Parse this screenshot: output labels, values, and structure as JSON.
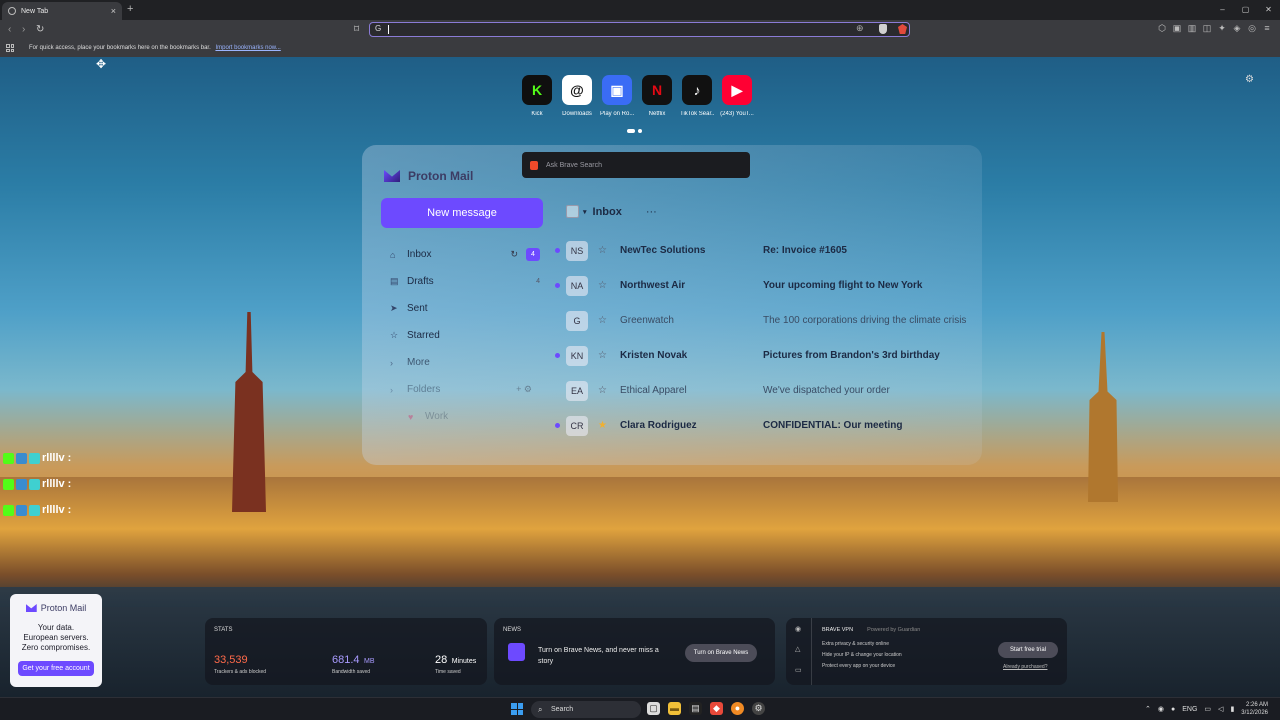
{
  "browser": {
    "tab_title": "New Tab",
    "tab_close": "×",
    "new_tab": "+",
    "window_controls": [
      "–",
      "▢",
      "✕"
    ],
    "omnibox_prefix": "G",
    "bookmarks_bar_message": "For quick access, place your bookmarks here on the bookmarks bar.",
    "bookmarks_import_link": "Import bookmarks now..."
  },
  "top_sites": [
    {
      "label": "Kick",
      "glyph": "K",
      "color": "#53fc18",
      "bg": "#0f0f0f"
    },
    {
      "label": "Downloads",
      "glyph": "@",
      "color": "#111111",
      "bg": "#ffffff"
    },
    {
      "label": "Play on Ro...",
      "glyph": "▣",
      "color": "#ffffff",
      "bg": "#3a6cf5"
    },
    {
      "label": "Netflix",
      "glyph": "N",
      "color": "#e50914",
      "bg": "#111111"
    },
    {
      "label": "TikTok Sear...",
      "glyph": "♪",
      "color": "#ffffff",
      "bg": "#111111"
    },
    {
      "label": "(243) YouT...",
      "glyph": "▶",
      "color": "#ffffff",
      "bg": "#ff0033"
    }
  ],
  "search": {
    "placeholder": "Ask Brave Search"
  },
  "proton_mail": {
    "brand": "Proton Mail",
    "new_message": "New message",
    "nav": [
      {
        "label": "Inbox",
        "icon": "inbox-icon",
        "glyph": "⌂",
        "count": "4"
      },
      {
        "label": "Drafts",
        "icon": "file-icon",
        "glyph": "▤",
        "count": "4"
      },
      {
        "label": "Sent",
        "icon": "send-icon",
        "glyph": "➤",
        "count": ""
      },
      {
        "label": "Starred",
        "icon": "star-icon",
        "glyph": "☆",
        "count": ""
      },
      {
        "label": "More",
        "icon": "chevron-icon",
        "glyph": "›",
        "count": ""
      },
      {
        "label": "Folders",
        "icon": "chevron-icon",
        "glyph": "›",
        "count": ""
      },
      {
        "label": "Work",
        "icon": "folder-icon",
        "glyph": "♥",
        "count": ""
      }
    ],
    "list_title": "Inbox",
    "list_more": "···",
    "messages": [
      {
        "initials": "NS",
        "sender": "NewTec Solutions",
        "subject": "Re: Invoice #1605",
        "unread": true
      },
      {
        "initials": "NA",
        "sender": "Northwest Air",
        "subject": "Your upcoming flight to New York",
        "unread": true
      },
      {
        "initials": "G",
        "sender": "Greenwatch",
        "subject": "The 100 corporations driving the climate crisis",
        "unread": false
      },
      {
        "initials": "KN",
        "sender": "Kristen Novak",
        "subject": "Pictures from Brandon's 3rd birthday",
        "unread": true
      },
      {
        "initials": "EA",
        "sender": "Ethical Apparel",
        "subject": "We've dispatched your order",
        "unread": false
      },
      {
        "initials": "CR",
        "sender": "Clara Rodriguez",
        "subject": "CONFIDENTIAL: Our meeting",
        "unread": true
      }
    ]
  },
  "stats": {
    "label": "STATS",
    "trackers": {
      "value": "33,539",
      "unit": "",
      "caption": "Trackers & ads blocked",
      "color": "#ff6a4a"
    },
    "bandwidth": {
      "value": "681.4",
      "unit": "MB",
      "caption": "Bandwidth saved",
      "color": "#a99bff"
    },
    "time": {
      "value": "28",
      "unit": "Minutes",
      "caption": "Time saved",
      "color": "#ffffff"
    }
  },
  "news": {
    "label": "NEWS",
    "text": "Turn on Brave News, and never miss a story",
    "button": "Turn on Brave News"
  },
  "vpn": {
    "title": "BRAVE VPN",
    "powered": "Powered by  Guardian",
    "features": [
      "Extra privacy & security online",
      "Hide your IP & change your location",
      "Protect every app on your device"
    ],
    "trial_button": "Start free trial",
    "already": "Already purchased?"
  },
  "ad": {
    "brand": "Proton Mail",
    "line1": "Your data.",
    "line2": "European servers.",
    "line3": "Zero compromises.",
    "button": "Get your free account"
  },
  "chat_overlay": [
    "rllllv :",
    "rllllv :",
    "rllllv :"
  ],
  "taskbar": {
    "search": "Search",
    "lang": "ENG",
    "time": "2:26 AM",
    "date": "3/12/2026"
  }
}
